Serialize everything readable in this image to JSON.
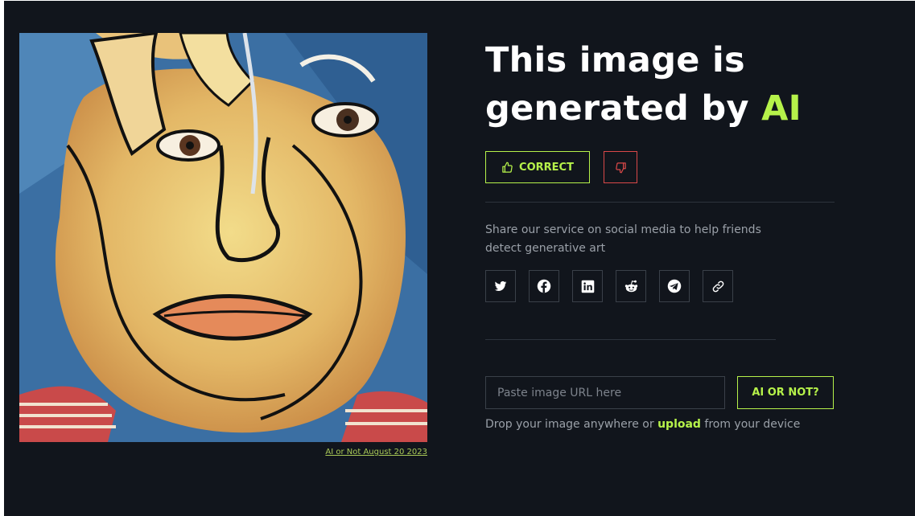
{
  "result": {
    "headline_line1": "This image is",
    "headline_line2": "generated by ",
    "headline_accent": "AI"
  },
  "feedback": {
    "correct_label": "CORRECT",
    "correct_icon": "thumbs-up-icon",
    "wrong_icon": "thumbs-down-icon"
  },
  "share": {
    "text": "Share our service on social media to help friends detect generative art",
    "networks": [
      "twitter",
      "facebook",
      "linkedin",
      "reddit",
      "telegram",
      "copy-link"
    ]
  },
  "checker": {
    "placeholder": "Paste image URL here",
    "button_label": "AI OR NOT?",
    "drop_prefix": "Drop your image anywhere or ",
    "upload_label": "upload",
    "drop_suffix": " from your device"
  },
  "image": {
    "caption": "AI or Not August 20 2023"
  },
  "colors": {
    "background": "#11151c",
    "accent": "#b6f24a",
    "danger": "#d94848",
    "muted_text": "#9aa0a8"
  }
}
